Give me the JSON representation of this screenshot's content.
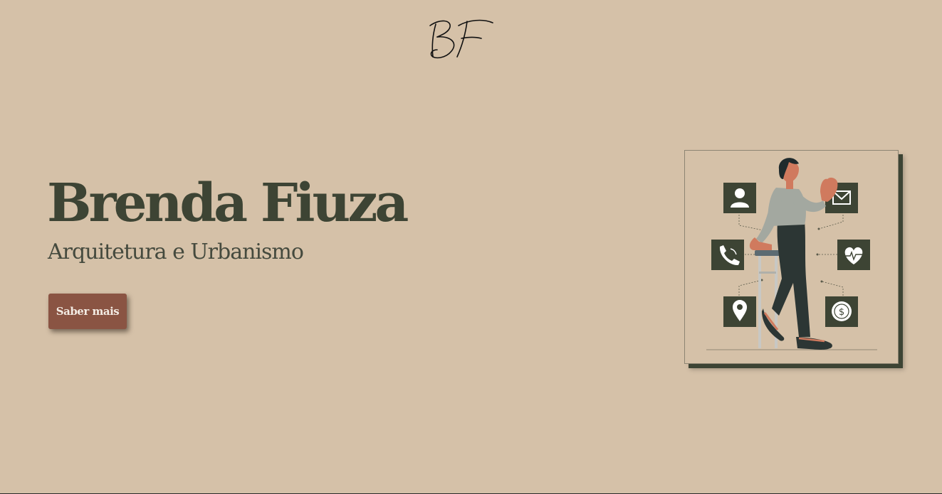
{
  "header": {
    "logo_text": "BF"
  },
  "hero": {
    "name": "Brenda Fiuza",
    "subtitle": "Arquitetura e Urbanismo",
    "cta_label": "Saber mais"
  },
  "illustration": {
    "icons": [
      "user-icon",
      "mail-icon",
      "phone-icon",
      "heart-pulse-icon",
      "location-pin-icon",
      "dollar-coin-icon"
    ]
  },
  "colors": {
    "background": "#d5c1a8",
    "primary_text": "#3d4434",
    "button": "#8a5443",
    "icon_tile": "#3d4434"
  }
}
